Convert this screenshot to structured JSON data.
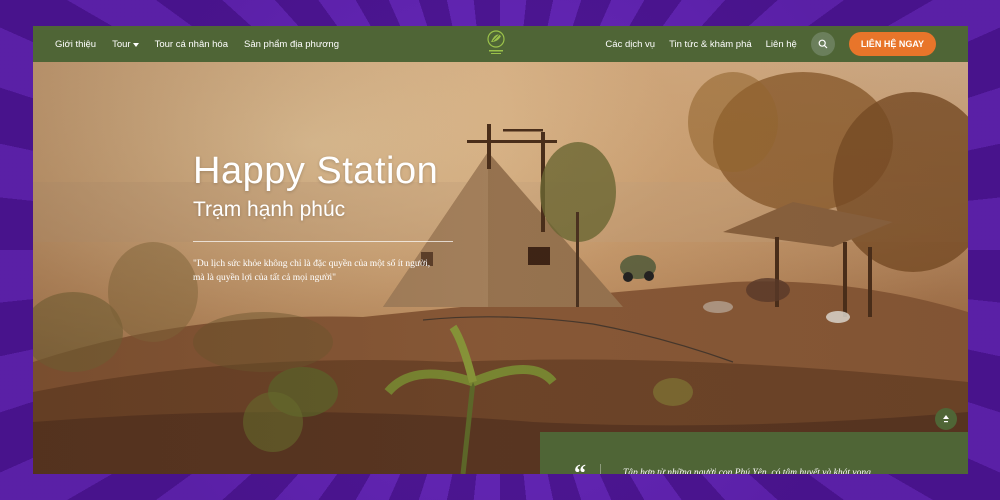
{
  "nav": {
    "left": [
      {
        "label": "Giới thiệu"
      },
      {
        "label": "Tour"
      },
      {
        "label": "Tour cá nhân hóa"
      },
      {
        "label": "Sản phẩm địa phương"
      }
    ],
    "right": [
      {
        "label": "Các dịch vụ"
      },
      {
        "label": "Tin tức & khám phá"
      },
      {
        "label": "Liên hệ"
      }
    ],
    "cta_label": "LIÊN HỆ NGAY",
    "search_icon": "search-icon",
    "logo_icon": "leaf-logo"
  },
  "hero": {
    "title": "Happy Station",
    "subtitle": "Trạm hạnh phúc",
    "quote_line1": "\"Du lịch sức khỏe không chỉ là đặc quyền của một số ít người,",
    "quote_line2": "mà là quyền lợi của tất cả mọi người\""
  },
  "testimonial": {
    "mark": "“",
    "text": "Tập hợp từ những người con Phú Yên, có tâm huyết và khát vọng khai phá tiềm lực, đem lại sự thịnh vượng cho cộng đồng.."
  },
  "colors": {
    "nav_bg": "#4f6536",
    "cta": "#e8752a",
    "background_purple": "#5b1fa0"
  }
}
